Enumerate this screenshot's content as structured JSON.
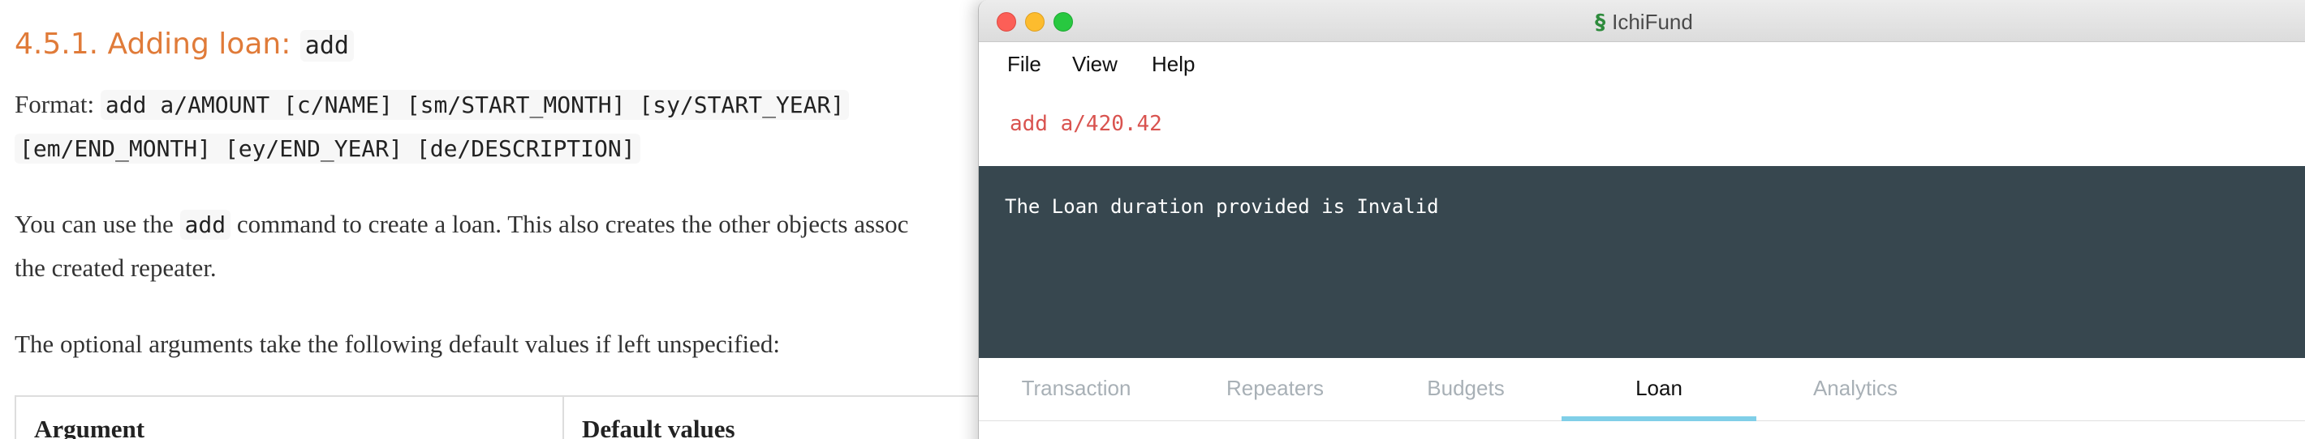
{
  "doc": {
    "heading_text": "4.5.1. Adding loan: ",
    "heading_code": "add",
    "format_label": "Format: ",
    "format_line1": "add a/AMOUNT [c/NAME] [sm/START_MONTH] [sy/START_YEAR]",
    "format_line2": "[em/END_MONTH] [ey/END_YEAR] [de/DESCRIPTION]",
    "use_pre": "You can use the ",
    "use_code": "add",
    "use_post": " command to create a loan. This also creates the other objects assoc",
    "use_line2": "the created repeater.",
    "optional_text": "The optional arguments take the following default values if left unspecified:",
    "table_headers": [
      "Argument",
      "Default values"
    ]
  },
  "app": {
    "title": "IchiFund",
    "icon": "ichifund-logo-icon",
    "menu": [
      "File",
      "View",
      "Help"
    ],
    "command_value": "add a/420.42",
    "result_text": "The Loan duration provided is Invalid",
    "tabs": [
      "Transaction",
      "Repeaters",
      "Budgets",
      "Loan",
      "Analytics"
    ],
    "active_tab": "Loan",
    "colors": {
      "result_bg": "#37474f",
      "command_text": "#d9534f",
      "active_tab_indicator": "#80cfe8",
      "heading": "#e07b39"
    }
  }
}
